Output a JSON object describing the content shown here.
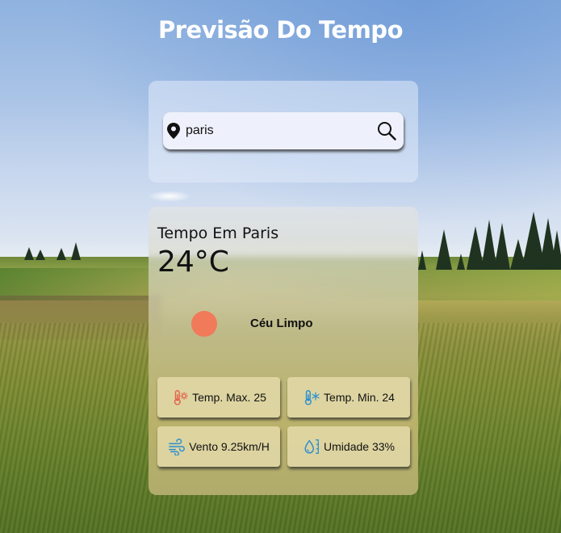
{
  "header": {
    "title": "Previsão Do Tempo"
  },
  "search": {
    "value": "paris"
  },
  "weather": {
    "city_label": "Tempo Em Paris",
    "temperature": "24°C",
    "condition": "Céu Limpo"
  },
  "stats": {
    "temp_max": "Temp. Max. 25",
    "temp_min": "Temp. Min. 24",
    "wind": "Vento 9.25km/H",
    "humidity": "Umidade 33%"
  },
  "colors": {
    "sun": "#f07a5a",
    "icon_hot": "#e3624a",
    "icon_cold": "#2a8fd0"
  },
  "icons": [
    "location-pin-icon",
    "search-icon",
    "sun-icon",
    "thermometer-hot-icon",
    "thermometer-cold-icon",
    "wind-icon",
    "humidity-icon"
  ]
}
